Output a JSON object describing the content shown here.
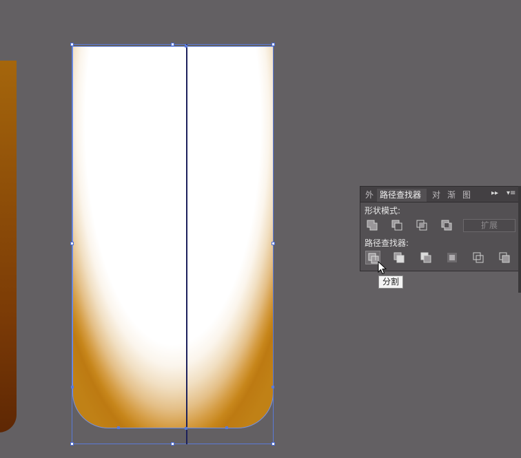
{
  "panel": {
    "tabs": [
      "外",
      "路径查找器",
      "对",
      "渐",
      "图"
    ],
    "shape_modes_label": "形状模式:",
    "expand_label": "扩展",
    "pathfinders_label": "路径查找器:",
    "shape_mode_icons": [
      "unite-icon",
      "minus-front-icon",
      "intersect-icon",
      "exclude-icon"
    ],
    "pathfinder_icons": [
      "divide-icon",
      "trim-icon",
      "merge-icon",
      "crop-icon",
      "outline-icon",
      "minus-back-icon"
    ],
    "tooltip": "分割"
  },
  "colors": {
    "canvas_bg": "#636063",
    "shape_fill_bottom": "#c08116",
    "selection": "#5a7ad9"
  }
}
